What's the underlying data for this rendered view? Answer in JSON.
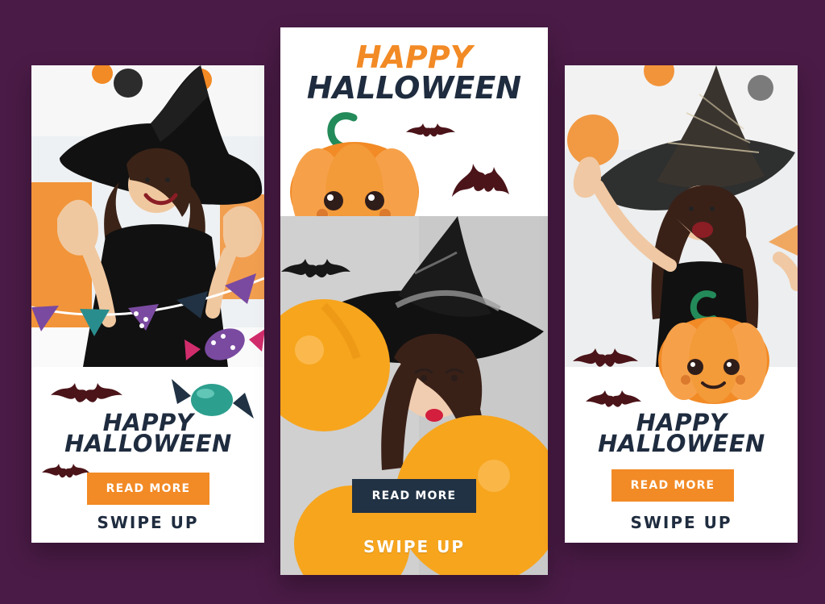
{
  "colors": {
    "background": "#4a1b46",
    "card": "#ffffff",
    "orange": "#f28a25",
    "navy": "#203244",
    "title_dark": "#1f2c3f"
  },
  "cards": [
    {
      "title_line1": "HAPPY",
      "title_line2": "HALLOWEEN",
      "button_label": "READ MORE",
      "swipe_label": "SWIPE UP"
    },
    {
      "title_line1": "HAPPY",
      "title_line2": "HALLOWEEN",
      "button_label": "READ MORE",
      "swipe_label": "SWIPE UP"
    },
    {
      "title_line1": "HAPPY",
      "title_line2": "HALLOWEEN",
      "button_label": "READ MORE",
      "swipe_label": "SWIPE UP"
    }
  ],
  "icons": [
    "bat-icon",
    "pumpkin-icon",
    "candy-icon",
    "bunting-icon",
    "witch-hat-icon"
  ]
}
